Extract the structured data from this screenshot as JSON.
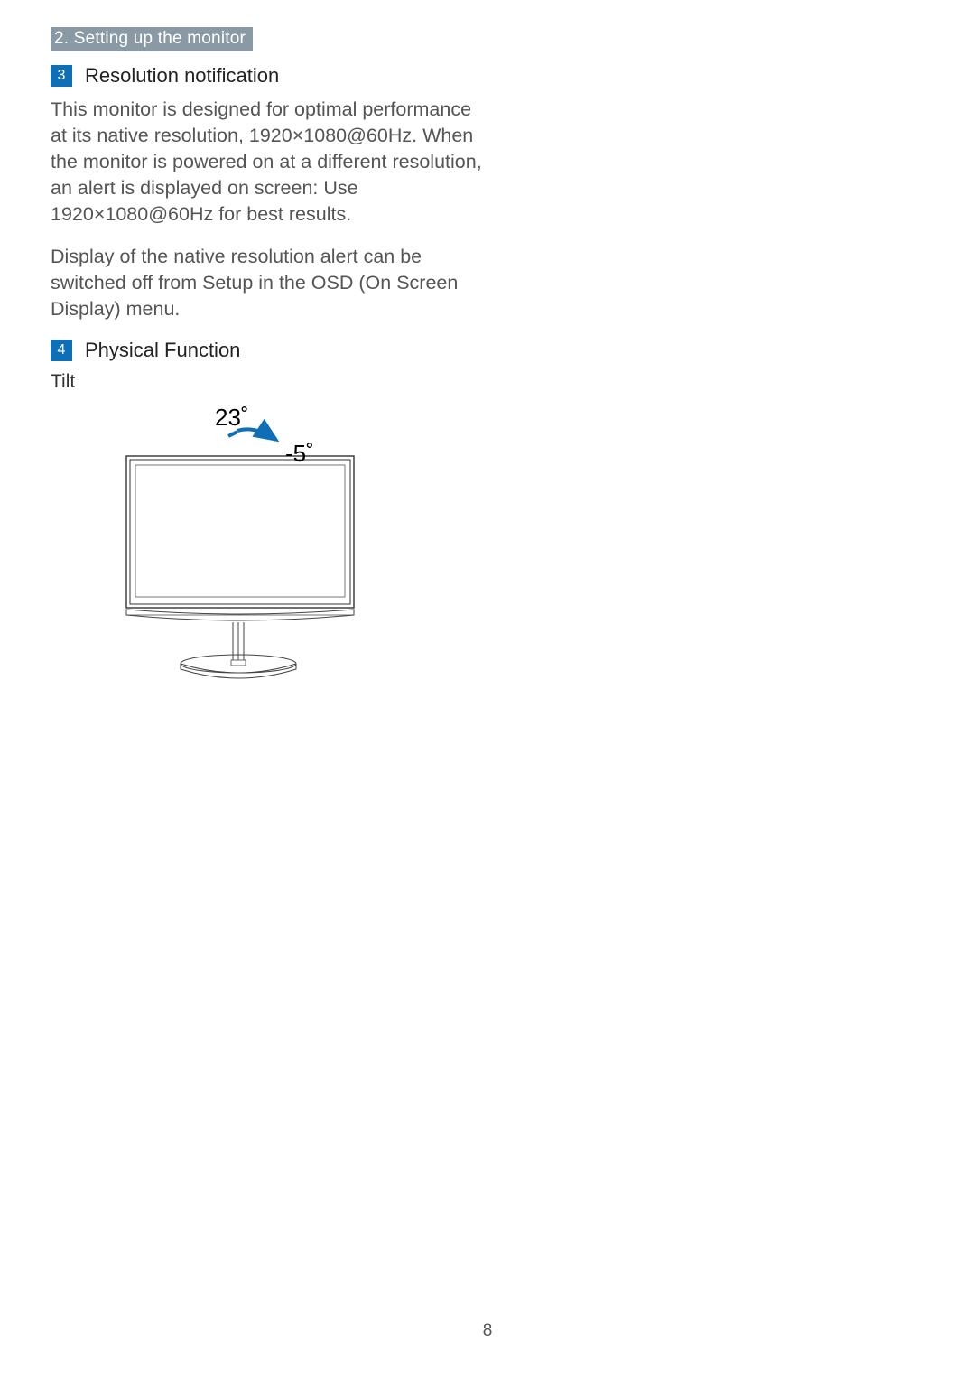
{
  "chapter_tag": "2. Setting up the monitor",
  "section3": {
    "num": "3",
    "title": "Resolution notification",
    "para1": "This monitor is designed for optimal performance at its native resolution, 1920×1080@60Hz. When the monitor is powered on at a different resolution, an alert is displayed on screen: Use 1920×1080@60Hz for best results.",
    "para2": "Display of the native resolution alert can be switched off from Setup in the OSD (On Screen Display) menu."
  },
  "section4": {
    "num": "4",
    "title": "Physical Function",
    "tilt_label": "Tilt",
    "tilt_back_deg": "23˚",
    "tilt_fwd_deg": "-5˚"
  },
  "page_number": "8"
}
